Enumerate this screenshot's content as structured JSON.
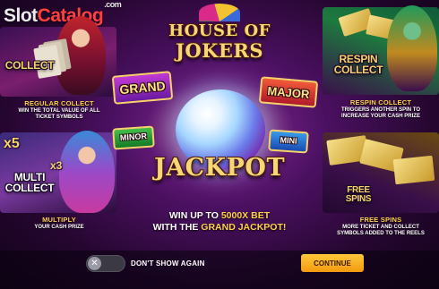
{
  "watermark": {
    "part1": "Slot",
    "part2": "Catalog",
    "suffix": ".com"
  },
  "logo": {
    "line1": "HOUSE OF",
    "line2": "JOKERS"
  },
  "jackpots": {
    "grand": "GRAND",
    "major": "MAJOR",
    "minor": "MINOR",
    "mini": "MINI"
  },
  "center": {
    "jackpot_word": "JACKPOT",
    "win_line1_pre": "WIN UP TO ",
    "win_line1_amount": "5000X BET",
    "win_line2_pre": "WITH THE ",
    "win_line2_grand": "GRAND JACKPOT!"
  },
  "features": {
    "regular_collect": {
      "panel_word": "COLLECT",
      "title": "REGULAR COLLECT",
      "desc_line1": "WIN THE TOTAL VALUE OF ALL",
      "desc_line2": "TICKET SYMBOLS"
    },
    "respin_collect": {
      "panel_word_line1": "RESPIN",
      "panel_word_line2": "COLLECT",
      "title": "RESPIN COLLECT",
      "desc_line1": "TRIGGERS ANOTHER SPIN TO",
      "desc_line2": "INCREASE YOUR CASH PRIZE"
    },
    "multiply": {
      "panel_word_line1": "MULTI",
      "panel_word_line2": "COLLECT",
      "multiplier_a": "x5",
      "multiplier_b": "x3",
      "title": "MULTIPLY",
      "desc_line1": "YOUR CASH PRIZE"
    },
    "free_spins": {
      "panel_word_line1": "FREE",
      "panel_word_line2": "SPINS",
      "title": "FREE SPINS",
      "desc_line1": "MORE TICKET AND COLLECT",
      "desc_line2": "SYMBOLS ADDED TO THE REELS"
    }
  },
  "footer": {
    "toggle_icon": "x-icon",
    "dont_show_label": "DON'T SHOW AGAIN",
    "continue_label": "CONTINUE"
  },
  "colors": {
    "accent_gold": "#ffd24a",
    "continue_button": "#f8b22a"
  }
}
